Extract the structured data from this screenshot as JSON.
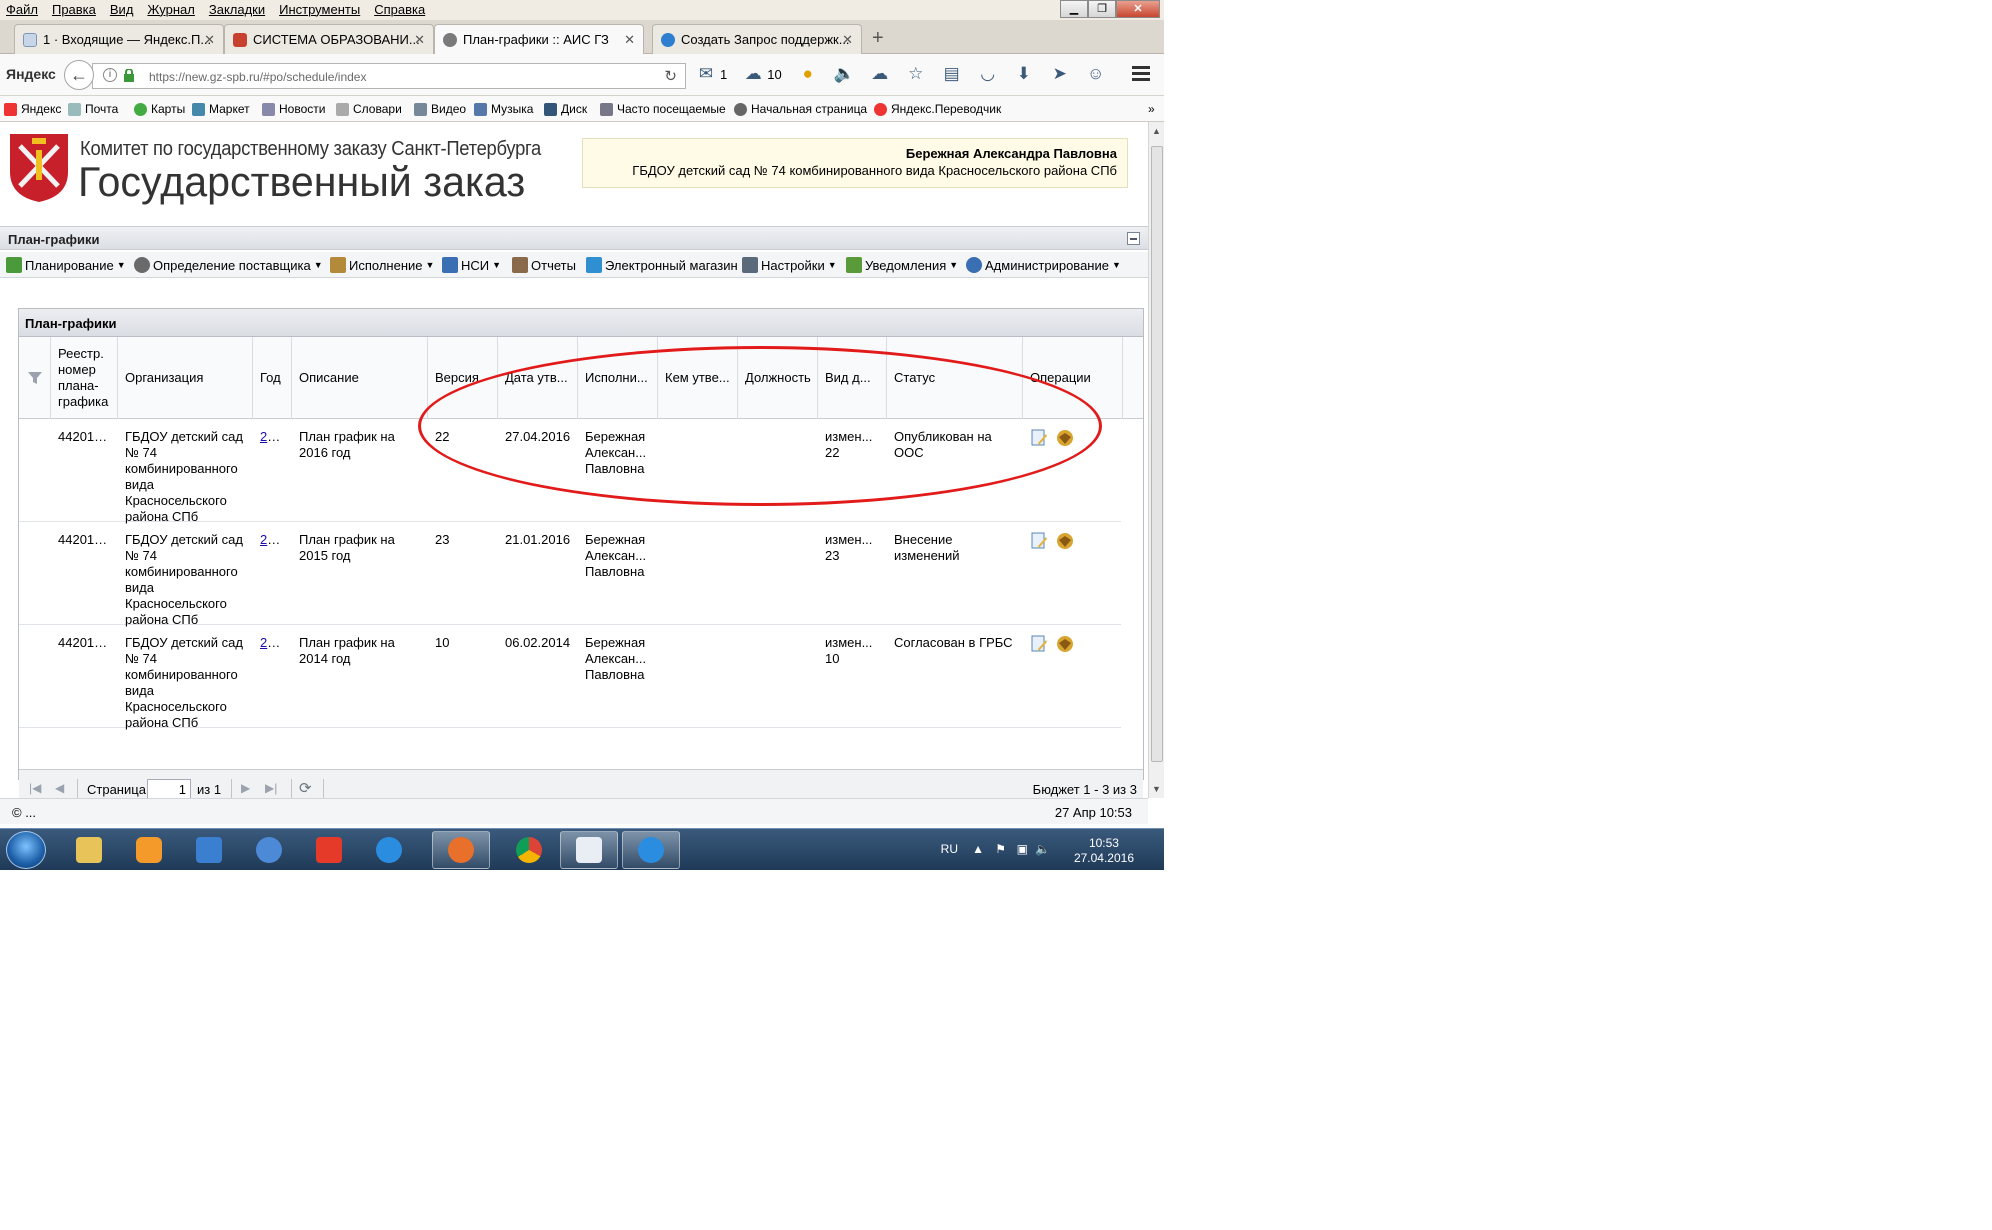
{
  "browser": {
    "menu": [
      "Файл",
      "Правка",
      "Вид",
      "Журнал",
      "Закладки",
      "Инструменты",
      "Справка"
    ],
    "tabs": [
      {
        "label": "1 · Входящие — Яндекс.П..."
      },
      {
        "label": "СИСТЕМА ОБРАЗОВАНИ..."
      },
      {
        "label": "План-графики :: АИС ГЗ"
      },
      {
        "label": "Создать Запрос поддержк..."
      }
    ],
    "brand": "Яндекс",
    "url": "https://new.gz-spb.ru/#po/schedule/index",
    "mail_count": "1",
    "weather": "10",
    "bookmarks": [
      "Яндекс",
      "Почта",
      "Карты",
      "Маркет",
      "Новости",
      "Словари",
      "Видео",
      "Музыка",
      "Диск",
      "Часто посещаемые",
      "Начальная страница",
      "Яндекс.Переводчик"
    ]
  },
  "header": {
    "org_line1": "Комитет по государственному заказу Санкт-Петербурга",
    "org_line2": "Государственный заказ",
    "user_name": "Бережная Александра Павловна",
    "user_org": "ГБДОУ детский сад № 74 комбинированного вида Красносельского района СПб"
  },
  "section_title": "План-графики",
  "toolbar": [
    {
      "label": "Планирование",
      "dropdown": true,
      "color": "#4a9a3c"
    },
    {
      "label": "Определение поставщика",
      "dropdown": true,
      "color": "#6a6a6a"
    },
    {
      "label": "Исполнение",
      "dropdown": true,
      "color": "#b38a3a"
    },
    {
      "label": "НСИ",
      "dropdown": true,
      "color": "#3a6fb3"
    },
    {
      "label": "Отчеты",
      "dropdown": false,
      "color": "#8a6a4a"
    },
    {
      "label": "Электронный магазин",
      "dropdown": false,
      "color": "#2f8fd0"
    },
    {
      "label": "Настройки",
      "dropdown": true,
      "color": "#5a6a7a"
    },
    {
      "label": "Уведомления",
      "dropdown": true,
      "color": "#5a9a3a"
    },
    {
      "label": "Администрирование",
      "dropdown": true,
      "color": "#3a6fb3"
    }
  ],
  "grid": {
    "title": "План-графики",
    "columns": [
      "Реестр. номер плана-графика",
      "Организация",
      "Год",
      "Описание",
      "Версия",
      "Дата утв...",
      "Исполни...",
      "Кем утве...",
      "Должность",
      "Вид д...",
      "Статус",
      "Операции"
    ],
    "rows": [
      {
        "reg": "442016...",
        "org": "ГБДОУ детский сад № 74 комбинированного вида Красносельского района СПб",
        "year": "20...",
        "desc": "План график на 2016 год",
        "version": "22",
        "date": "27.04.2016",
        "executor": "Бережная Алексан... Павловна",
        "approved_by": "",
        "position": "",
        "kind": "измен... 22",
        "status": "Опубликован на ООС"
      },
      {
        "reg": "442015...",
        "org": "ГБДОУ детский сад № 74 комбинированного вида Красносельского района СПб",
        "year": "20...",
        "desc": "План график на 2015 год",
        "version": "23",
        "date": "21.01.2016",
        "executor": "Бережная Алексан... Павловна",
        "approved_by": "",
        "position": "",
        "kind": "измен... 23",
        "status": "Внесение изменений"
      },
      {
        "reg": "442014...",
        "org": "ГБДОУ детский сад № 74 комбинированного вида Красносельского района СПб",
        "year": "20...",
        "desc": "План график на 2014 год",
        "version": "10",
        "date": "06.02.2014",
        "executor": "Бережная Алексан... Павловна",
        "approved_by": "",
        "position": "",
        "kind": "измен... 10",
        "status": "Согласован в ГРБС"
      }
    ],
    "pager": {
      "page_label": "Страница",
      "page_value": "1",
      "of_label": "из 1",
      "display": "Бюджет 1 - 3 из 3"
    }
  },
  "footer": {
    "copyright": "© ...",
    "datetime": "27 Апр 10:53"
  },
  "taskbar": {
    "lang": "RU",
    "time": "10:53",
    "date": "27.04.2016"
  },
  "annotation_color": "#e21a1a"
}
